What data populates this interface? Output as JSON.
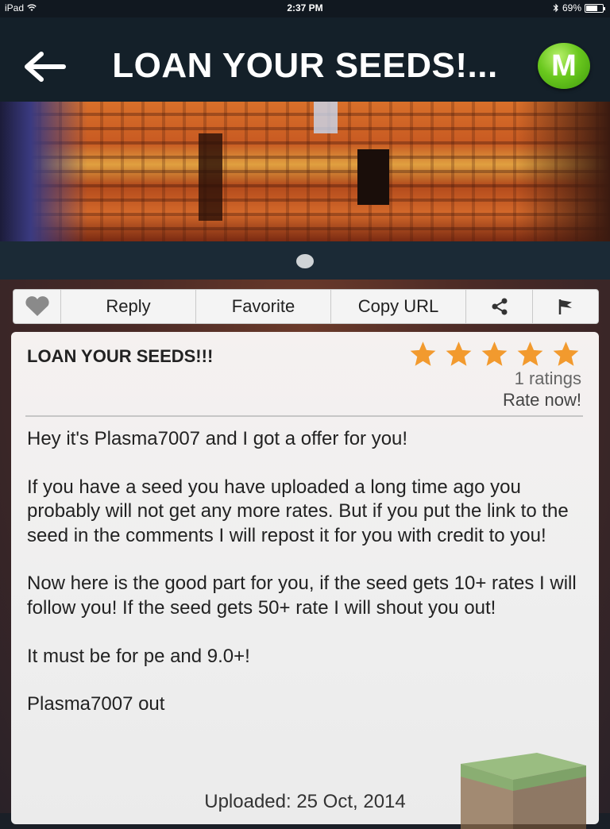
{
  "status_bar": {
    "device": "iPad",
    "time": "2:37 PM",
    "battery": "69%",
    "battery_level": 0.69
  },
  "nav": {
    "title": "LOAN YOUR SEEDS!...",
    "back_icon": "back-arrow-icon",
    "logo_letter": "M"
  },
  "banner": {
    "pager_pages": 1,
    "active_page": 1
  },
  "toolbar": {
    "heart_icon": "heart-icon",
    "reply_label": "Reply",
    "favorite_label": "Favorite",
    "copy_url_label": "Copy URL",
    "share_icon": "share-icon",
    "flag_icon": "flag-icon"
  },
  "post": {
    "title": "LOAN YOUR SEEDS!!!",
    "stars": 5,
    "star_color": "#f29a2e",
    "ratings_count": "1 ratings",
    "rate_now": "Rate now!",
    "paragraphs": [
      "Hey it's Plasma7007 and I got a offer for you!",
      "If you have a seed you have uploaded a long time ago you probably will not get any more rates. But if you put the link to the seed in the comments I will repost it for you with credit to you!",
      "Now here is the good part for you, if the seed gets 10+ rates I will follow you! If the seed gets 50+ rate I will shout you out!",
      "It must be for pe and 9.0+!",
      "Plasma7007 out"
    ],
    "uploaded": "Uploaded: 25 Oct, 2014"
  },
  "colors": {
    "navbar": "#142029",
    "logo_green": "#6ac81e",
    "card_bg": "#efefef"
  }
}
